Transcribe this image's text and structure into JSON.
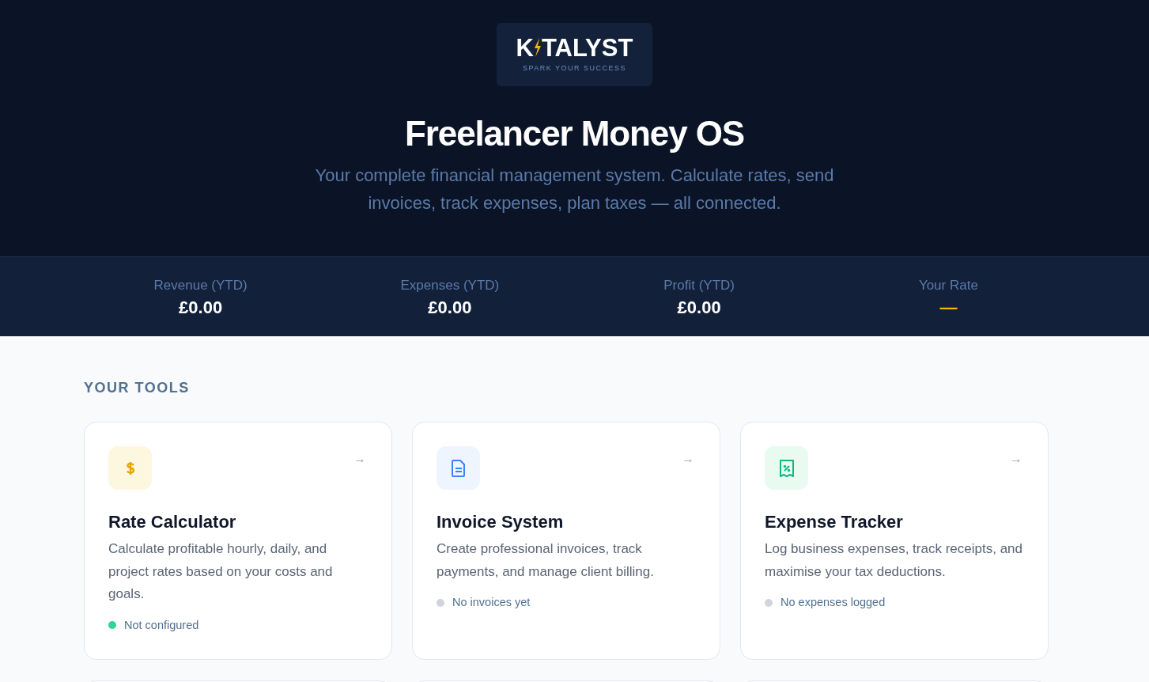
{
  "logo": {
    "left": "K",
    "right": "TALYST",
    "tagline": "SPARK YOUR SUCCESS"
  },
  "hero": {
    "title": "Freelancer Money OS",
    "subtitle": "Your complete financial management system. Calculate rates, send invoices, track expenses, plan taxes — all connected."
  },
  "stats": [
    {
      "label": "Revenue (YTD)",
      "value": "£0.00",
      "kind": "amount"
    },
    {
      "label": "Expenses (YTD)",
      "value": "£0.00",
      "kind": "amount"
    },
    {
      "label": "Profit (YTD)",
      "value": "£0.00",
      "kind": "amount"
    },
    {
      "label": "Your Rate",
      "value": "—",
      "kind": "empty"
    }
  ],
  "section_title": "YOUR TOOLS",
  "tools": [
    {
      "kind": "dollar",
      "title": "Rate Calculator",
      "arrow": "→",
      "description": "Calculate profitable hourly, daily, and project rates based on your costs and goals.",
      "status": "Not configured",
      "color": "#34d399"
    },
    {
      "kind": "document",
      "title": "Invoice System",
      "arrow": "→",
      "description": "Create professional invoices, track payments, and manage client billing.",
      "status": "No invoices yet",
      "color": "#d1d5db"
    },
    {
      "kind": "receipt",
      "title": "Expense Tracker",
      "arrow": "→",
      "description": "Log business expenses, track receipts, and maximise your tax deductions.",
      "status": "No expenses logged",
      "color": "#d1d5db"
    }
  ],
  "next_row": [
    {
      "kind": "card"
    },
    {
      "kind": "card"
    },
    {
      "kind": "card"
    }
  ]
}
